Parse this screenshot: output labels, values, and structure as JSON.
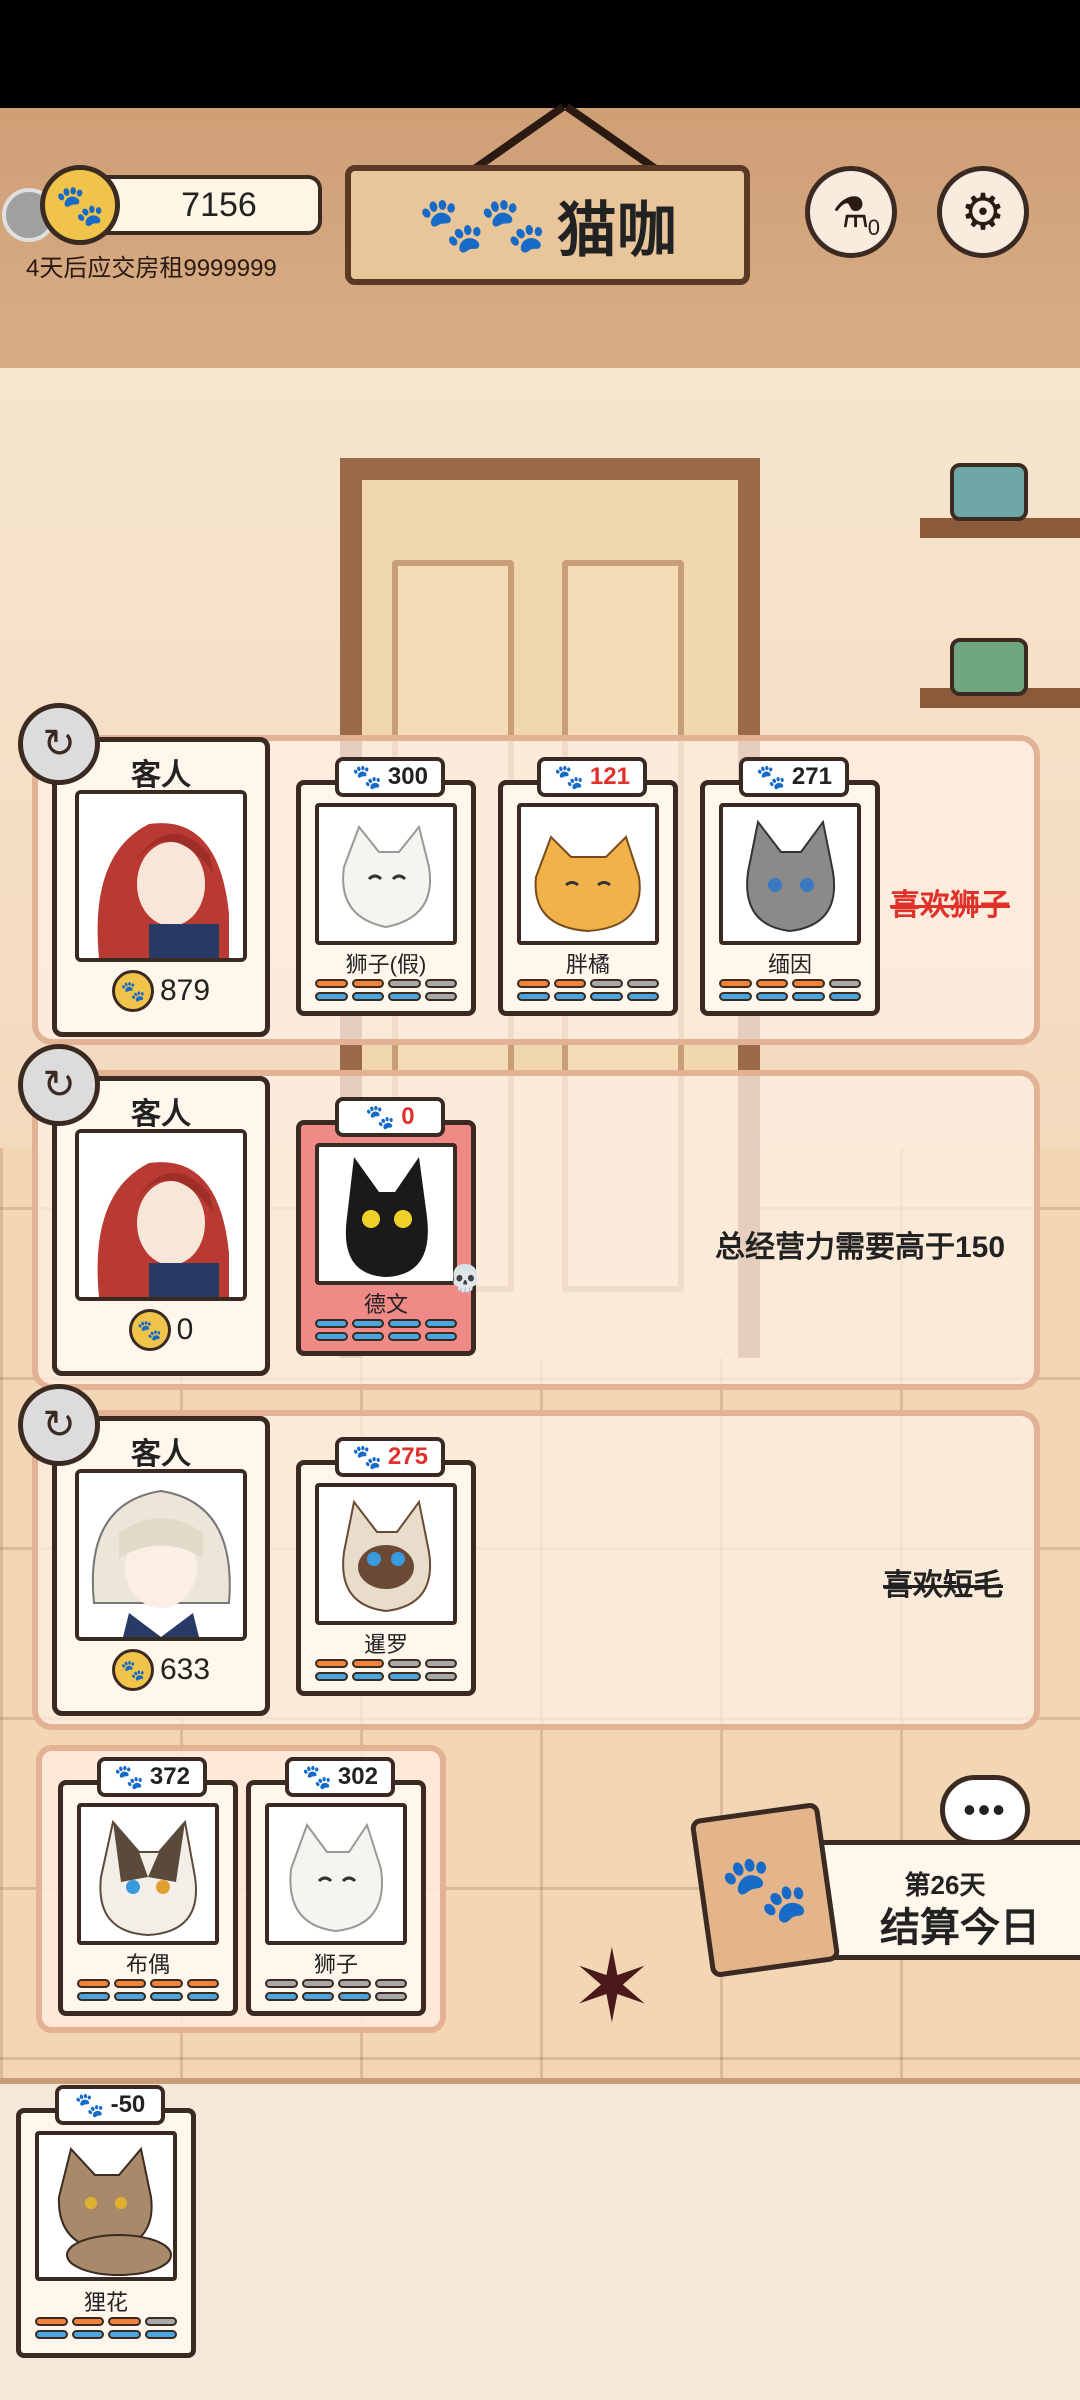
{
  "header": {
    "coins": "7156",
    "rent_notice": "4天后应交房租9999999",
    "title": "猫咖",
    "potion_count": "0",
    "icons": {
      "coin": "paw-coin-icon",
      "potion": "potion-icon",
      "settings": "gear-icon"
    }
  },
  "rows": [
    {
      "customer": {
        "title": "客人",
        "coins": "879"
      },
      "cats": [
        {
          "value": "300",
          "value_color": "normal",
          "name": "狮子(假)",
          "bars": [
            "o",
            "o",
            "g",
            "g",
            "b",
            "b",
            "b",
            "g"
          ]
        },
        {
          "value": "121",
          "value_color": "red",
          "name": "胖橘",
          "bars": [
            "o",
            "o",
            "g",
            "g",
            "b",
            "b",
            "b",
            "b"
          ]
        },
        {
          "value": "271",
          "value_color": "normal",
          "name": "缅因",
          "bars": [
            "o",
            "o",
            "o",
            "g",
            "b",
            "b",
            "b",
            "b"
          ]
        }
      ],
      "requirement": "喜欢狮子",
      "requirement_style": "struck-red"
    },
    {
      "customer": {
        "title": "客人",
        "coins": "0"
      },
      "cats": [
        {
          "value": "0",
          "value_color": "red",
          "name": "德文",
          "bars": [
            "b",
            "b",
            "b",
            "b",
            "b",
            "b",
            "b",
            "b"
          ]
        }
      ],
      "requirement": "总经营力需要高于150",
      "requirement_style": "normal"
    },
    {
      "customer": {
        "title": "客人",
        "coins": "633"
      },
      "cats": [
        {
          "value": "275",
          "value_color": "red",
          "name": "暹罗",
          "bars": [
            "o",
            "o",
            "g",
            "g",
            "b",
            "b",
            "b",
            "g"
          ]
        }
      ],
      "requirement": "喜欢短毛",
      "requirement_style": "struck"
    }
  ],
  "reserve_cats": [
    {
      "value": "372",
      "name": "布偶",
      "bars": [
        "o",
        "o",
        "o",
        "o",
        "b",
        "b",
        "b",
        "b"
      ]
    },
    {
      "value": "302",
      "name": "狮子",
      "bars": [
        "g",
        "g",
        "g",
        "g",
        "b",
        "b",
        "b",
        "g"
      ]
    }
  ],
  "bottom_cat": {
    "value": "-50",
    "name": "狸花",
    "bars": [
      "o",
      "o",
      "o",
      "g",
      "b",
      "b",
      "b",
      "b"
    ]
  },
  "daily": {
    "day_label": "第26天",
    "settle_label": "结算今日"
  },
  "colors": {
    "accent_red": "#e0312a",
    "frame": "#3a2a22",
    "coin": "#f0c44a"
  }
}
